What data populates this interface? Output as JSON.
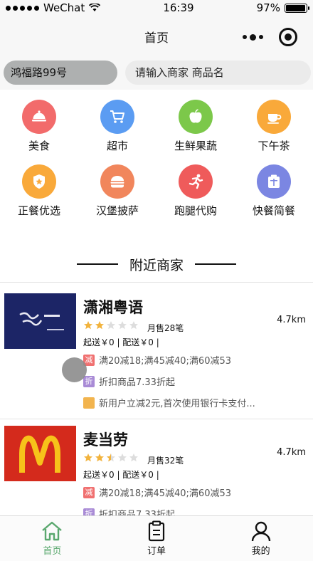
{
  "status_bar": {
    "carrier": "WeChat",
    "time": "16:39",
    "battery": "97%"
  },
  "nav": {
    "title": "首页"
  },
  "search": {
    "address": "鸿福路99号",
    "placeholder": "请输入商家 商品名"
  },
  "categories": [
    {
      "label": "美食",
      "icon": "food-cloche-icon",
      "color": "#f26b6b"
    },
    {
      "label": "超市",
      "icon": "shopping-cart-icon",
      "color": "#5b9cf2"
    },
    {
      "label": "生鲜果蔬",
      "icon": "apple-icon",
      "color": "#7cc84a"
    },
    {
      "label": "下午茶",
      "icon": "coffee-cup-icon",
      "color": "#f9a93a"
    },
    {
      "label": "正餐优选",
      "icon": "star-shield-icon",
      "color": "#f9a93a"
    },
    {
      "label": "汉堡披萨",
      "icon": "burger-icon",
      "color": "#f1865c"
    },
    {
      "label": "跑腿代购",
      "icon": "runner-icon",
      "color": "#ef5b5b"
    },
    {
      "label": "快餐简餐",
      "icon": "lunchbox-icon",
      "color": "#7b86e2"
    }
  ],
  "section_title": "附近商家",
  "shops": [
    {
      "name": "潇湘粤语",
      "rating": 2,
      "sales": "月售28笔",
      "fee": "起送￥0 | 配送￥0 |",
      "distance": "4.7km",
      "promos": [
        {
          "badge": "减",
          "badge_color": "#f07070",
          "text": "满20减18;满45减40;满60减53"
        },
        {
          "badge": "折",
          "badge_color": "#a98bd6",
          "text": "折扣商品7.33折起"
        },
        {
          "badge": "",
          "badge_color": "#f2b44e",
          "text": "新用户立减2元,首次使用银行卡支付..."
        }
      ]
    },
    {
      "name": "麦当劳",
      "rating": 2.5,
      "sales": "月售32笔",
      "fee": "起送￥0 | 配送￥0 |",
      "distance": "4.7km",
      "promos": [
        {
          "badge": "减",
          "badge_color": "#f07070",
          "text": "满20减18;满45减40;满60减53"
        },
        {
          "badge": "折",
          "badge_color": "#a98bd6",
          "text": "折扣商品7.33折起"
        }
      ]
    }
  ],
  "tabs": [
    {
      "label": "首页",
      "icon": "home-icon",
      "active": true
    },
    {
      "label": "订单",
      "icon": "clipboard-icon",
      "active": false
    },
    {
      "label": "我的",
      "icon": "user-icon",
      "active": false
    }
  ],
  "colors": {
    "active_tab": "#5aa86e",
    "star_on": "#f2b33d",
    "star_off": "#dddddd"
  }
}
